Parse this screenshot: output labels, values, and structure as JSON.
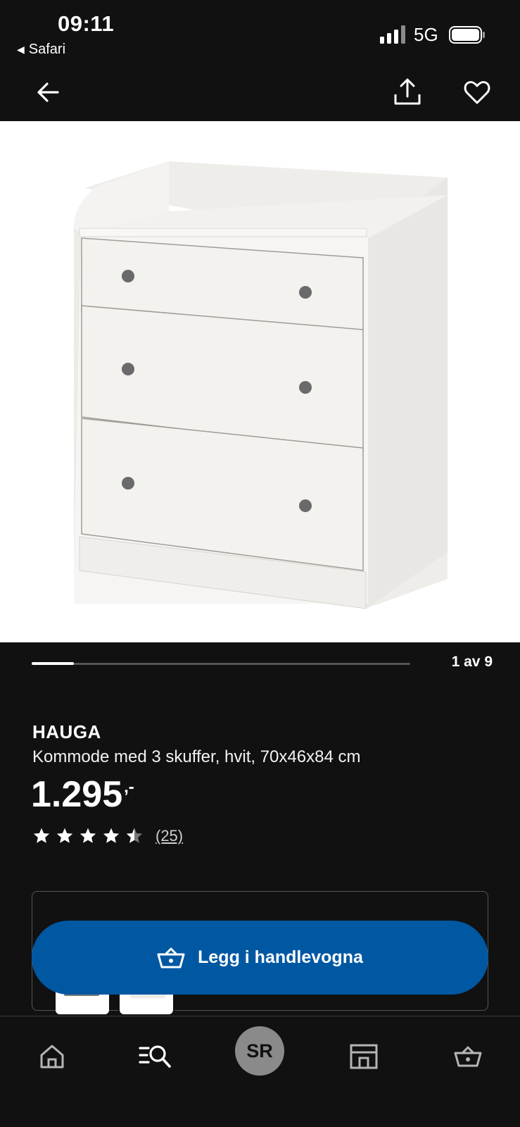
{
  "status_bar": {
    "time": "09:11",
    "back_app": "Safari",
    "network": "5G",
    "back_app_glyph": "◀"
  },
  "toolbar": {
    "back_icon": "arrow-left-icon",
    "share_icon": "share-icon",
    "favorite_icon": "heart-icon"
  },
  "gallery": {
    "counter": "1 av 9",
    "progress_fraction": 0.111
  },
  "product": {
    "brand": "HAUGA",
    "description": "Kommode med 3 skuffer, hvit, 70x46x84 cm",
    "price": "1.295",
    "price_suffix": ",-",
    "rating": 4.5,
    "rating_count": "(25)"
  },
  "cart_button": {
    "label": "Legg i handlevogna",
    "icon": "basket-icon",
    "color": "#0058a3"
  },
  "bottom_nav": {
    "items": [
      {
        "name": "home",
        "icon": "home-icon"
      },
      {
        "name": "search",
        "icon": "search-list-icon"
      },
      {
        "name": "profile",
        "initials": "SR"
      },
      {
        "name": "stores",
        "icon": "store-icon"
      },
      {
        "name": "cart",
        "icon": "basket-icon"
      }
    ]
  }
}
